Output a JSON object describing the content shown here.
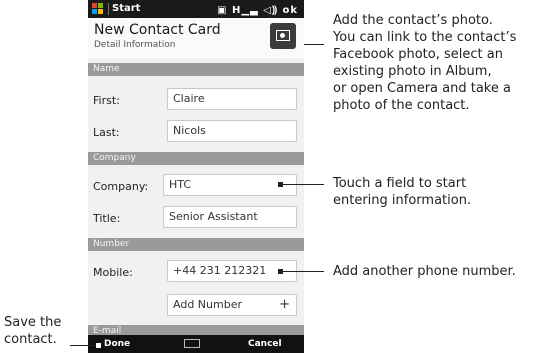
{
  "statusbar": {
    "app": "Start",
    "icons": "▣ H▁▃ ◁⸩ ok"
  },
  "header": {
    "title": "New Contact Card",
    "subtitle": "Detail Information"
  },
  "sections": {
    "name": "Name",
    "company": "Company",
    "number": "Number",
    "email": "E-mail"
  },
  "fields": {
    "first_label": "First:",
    "first_value": "Claire",
    "last_label": "Last:",
    "last_value": "Nicols",
    "company_label": "Company:",
    "company_value": "HTC",
    "title_label": "Title:",
    "title_value": "Senior Assistant",
    "mobile_label": "Mobile:",
    "mobile_value": "+44 231 212321"
  },
  "add_number_label": "Add Number",
  "add_number_symbol": "+",
  "softkeys": {
    "done": "Done",
    "cancel": "Cancel"
  },
  "callouts": {
    "photo": [
      "Add the contact’s photo.",
      "You can link to the contact’s",
      "Facebook photo, select an",
      "existing photo in Album,",
      "or open Camera and take a",
      "photo of the contact."
    ],
    "field": [
      "Touch a field to start",
      "entering information."
    ],
    "number": [
      "Add another phone number."
    ],
    "save": [
      "Save the",
      "contact."
    ]
  }
}
